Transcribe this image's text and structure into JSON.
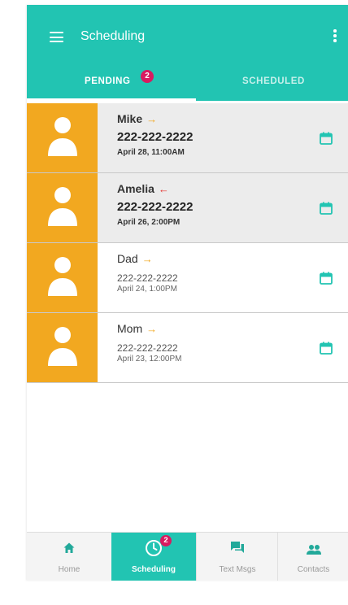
{
  "colors": {
    "primary": "#22c4b2",
    "avatar_bg": "#f2a820",
    "badge": "#d81b60",
    "arrow_out": "#f2a820",
    "arrow_in": "#e53935"
  },
  "appbar": {
    "title": "Scheduling",
    "menu_icon": "hamburger-menu-icon",
    "more_icon": "more-vertical-icon"
  },
  "tabs": {
    "pending": {
      "label": "PENDING",
      "badge": "2"
    },
    "scheduled": {
      "label": "SCHEDULED"
    }
  },
  "contacts": [
    {
      "name": "Mike",
      "arrow": "→",
      "direction": "outgoing",
      "phone": "222-222-2222",
      "date": "April 28, 11:00AM",
      "unread": true
    },
    {
      "name": "Amelia",
      "arrow": "←",
      "direction": "incoming",
      "phone": "222-222-2222",
      "date": "April 26, 2:00PM",
      "unread": true
    },
    {
      "name": "Dad",
      "arrow": "→",
      "direction": "outgoing",
      "phone": "222-222-2222",
      "date": "April 24, 1:00PM",
      "unread": false
    },
    {
      "name": "Mom",
      "arrow": "→",
      "direction": "outgoing",
      "phone": "222-222-2222",
      "date": "April 23, 12:00PM",
      "unread": false
    }
  ],
  "bottom_nav": {
    "home": {
      "label": "Home",
      "icon": "home-icon"
    },
    "scheduling": {
      "label": "Scheduling",
      "icon": "clock-icon",
      "badge": "2"
    },
    "text_msgs": {
      "label": "Text Msgs",
      "icon": "chat-icon"
    },
    "contacts": {
      "label": "Contacts",
      "icon": "people-icon"
    }
  }
}
